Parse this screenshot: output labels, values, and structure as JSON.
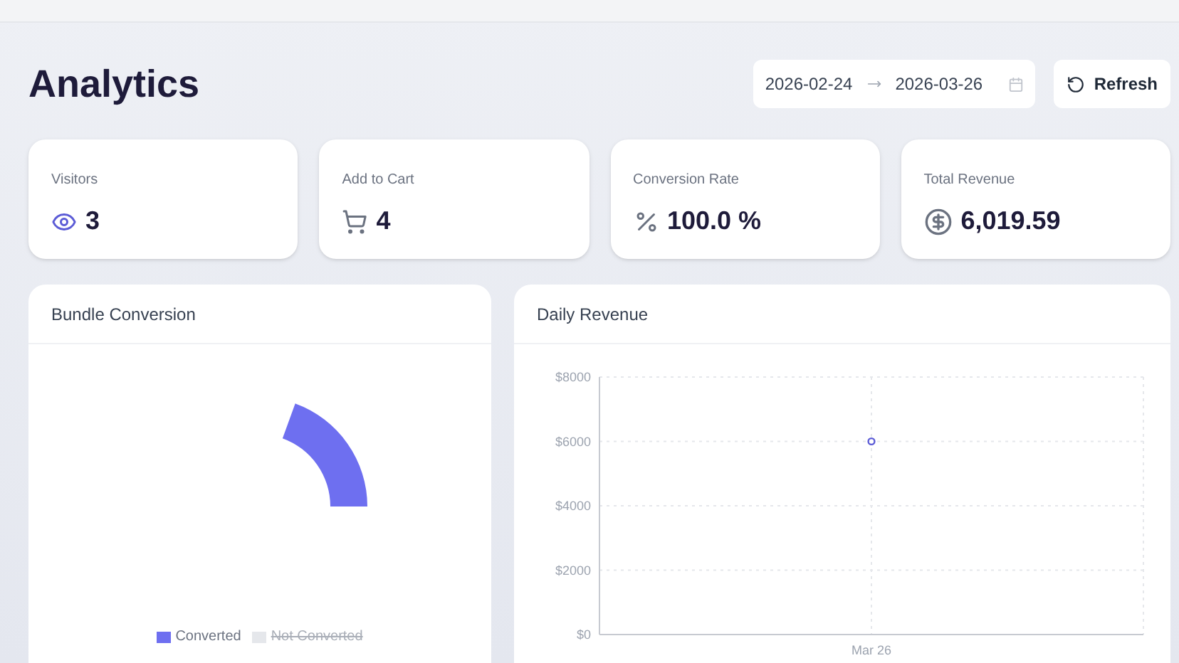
{
  "page": {
    "title": "Analytics"
  },
  "date_range": {
    "start": "2026-02-24",
    "end": "2026-03-26"
  },
  "refresh_button": {
    "label": "Refresh"
  },
  "stats": [
    {
      "kind": "visitors",
      "label": "Visitors",
      "value": "3"
    },
    {
      "kind": "cart",
      "label": "Add to Cart",
      "value": "4"
    },
    {
      "kind": "percent",
      "label": "Conversion Rate",
      "value": "100.0 %"
    },
    {
      "kind": "revenue",
      "label": "Total Revenue",
      "value": "6,019.59"
    }
  ],
  "bundle_conversion": {
    "title": "Bundle Conversion",
    "legend": [
      {
        "label": "Converted",
        "color": "#6e6ff0",
        "hidden": false
      },
      {
        "label": "Not Converted",
        "color": "#e5e7eb",
        "hidden": true
      }
    ]
  },
  "daily_revenue": {
    "title": "Daily Revenue",
    "chart_data": {
      "type": "line",
      "x": [
        "Mar 26"
      ],
      "grid": true,
      "series": [
        {
          "color": "#5b5bd6",
          "marker": true,
          "values": [
            6000
          ]
        }
      ],
      "ylim": [
        0,
        8000
      ],
      "yticks": [
        {
          "value": 0,
          "label": "$0"
        },
        {
          "value": 2000,
          "label": "$2000"
        },
        {
          "value": 4000,
          "label": "$4000"
        },
        {
          "value": 6000,
          "label": "$6000"
        },
        {
          "value": 8000,
          "label": "$8000"
        }
      ]
    }
  }
}
